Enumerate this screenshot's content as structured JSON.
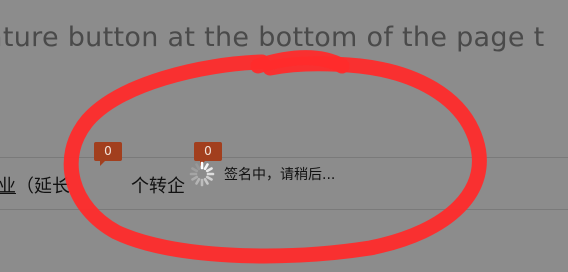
{
  "instruction": {
    "text": "ature button at the bottom of the page t"
  },
  "row": {
    "left_text_underlined": "业",
    "left_text": "（延长",
    "right_text": "个转企"
  },
  "badges": [
    {
      "count": "0"
    },
    {
      "count": "0"
    }
  ],
  "loading": {
    "message": "签名中，请稍后..."
  },
  "colors": {
    "background": "#8c8c8c",
    "badge": "#a23f1e",
    "annotation_circle": "#ff2b2b"
  },
  "icons": {
    "spinner": "loading-spinner-icon"
  }
}
